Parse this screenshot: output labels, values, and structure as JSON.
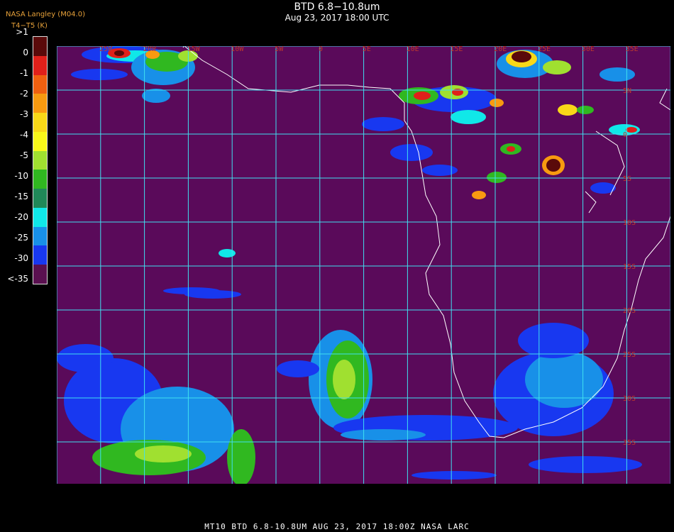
{
  "header": {
    "title": "BTD 6.8−10.8um",
    "subtitle": "Aug 23, 2017 18:00 UTC",
    "credit": "NASA Langley (M04.0)",
    "variable": "T4−T5 (K)",
    "overlap_text": "BTD"
  },
  "legend": {
    "colors": [
      "#5a0a0a",
      "#e0201a",
      "#f06010",
      "#f89a10",
      "#f8d818",
      "#f8f81a",
      "#a0e030",
      "#30b820",
      "#208858",
      "#10e8e8",
      "#1890e8",
      "#1838f0",
      "#5a1050"
    ],
    "labels": [
      ">1",
      "0",
      "-1",
      "-2",
      "-3",
      "-4",
      "-5",
      "-10",
      "-15",
      "-20",
      "-25",
      "-30",
      "<-35"
    ]
  },
  "map": {
    "background": "#5a0a5a",
    "grid_color": "#40e0f0",
    "coast_color": "#ffffff",
    "lon_labels": [
      "25W",
      "20W",
      "15W",
      "10W",
      "5W",
      "0",
      "5E",
      "10E",
      "15E",
      "20E",
      "25E",
      "30E",
      "35E"
    ],
    "lat_labels": [
      "5N",
      "0",
      "5S",
      "10S",
      "15S",
      "20S",
      "25S",
      "30S",
      "35S",
      "40S"
    ]
  },
  "footer": {
    "text": "MT10  BTD 6.8-10.8UM   AUG 23, 2017 18:00Z   NASA LARC"
  }
}
